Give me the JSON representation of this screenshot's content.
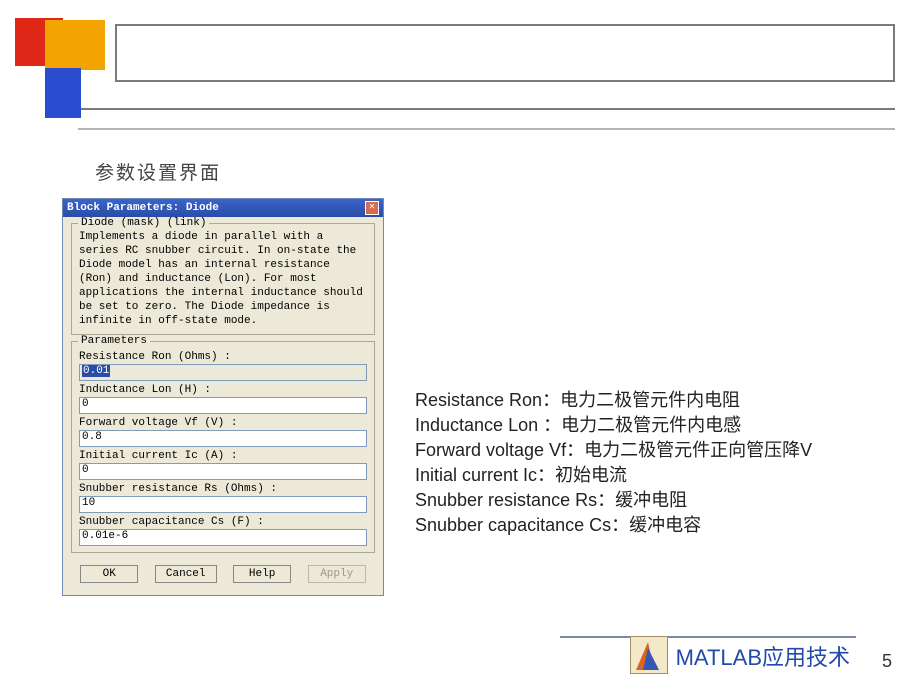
{
  "subtitle": "参数设置界面",
  "dialog": {
    "title": "Block Parameters: Diode",
    "close_glyph": "✕",
    "mask_legend": "Diode (mask) (link)",
    "description": "Implements a diode in parallel with a series RC snubber circuit. In on-state the Diode model has an internal resistance (Ron) and inductance (Lon). For most applications the internal inductance should be set to zero. The Diode impedance is infinite in off-state mode.",
    "params_legend": "Parameters",
    "params": [
      {
        "label": "Resistance Ron (Ohms) :",
        "value": "0.01",
        "selected": true
      },
      {
        "label": "Inductance Lon (H) :",
        "value": "0"
      },
      {
        "label": "Forward voltage Vf (V) :",
        "value": "0.8"
      },
      {
        "label": "Initial current Ic (A) :",
        "value": "0"
      },
      {
        "label": "Snubber resistance Rs (Ohms) :",
        "value": "10"
      },
      {
        "label": "Snubber capacitance Cs (F) :",
        "value": "0.01e-6"
      }
    ],
    "buttons": {
      "ok": "OK",
      "cancel": "Cancel",
      "help": "Help",
      "apply": "Apply"
    }
  },
  "explain": [
    "Resistance Ron：电力二极管元件内电阻",
    "Inductance Lon ：电力二极管元件内电感",
    "Forward voltage Vf：电力二极管元件正向管压降V",
    "Initial current Ic：初始电流",
    "Snubber resistance Rs：缓冲电阻",
    "Snubber capacitance Cs：缓冲电容"
  ],
  "footer_text": "MATLAB应用技术",
  "page_number": "5"
}
